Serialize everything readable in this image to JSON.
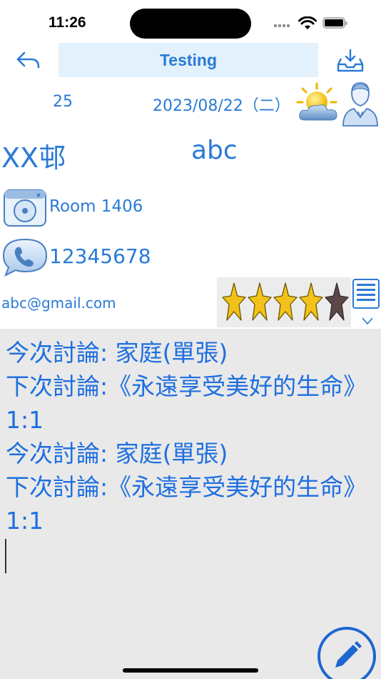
{
  "status_bar": {
    "time": "11:26"
  },
  "nav": {
    "title": "Testing"
  },
  "info": {
    "number": "25",
    "date": "2023/08/22（二）",
    "name": "XX邨",
    "label": "abc",
    "room": "Room 1406",
    "phone": "12345678",
    "email": "abc@gmail.com"
  },
  "rating": {
    "value": 4,
    "max": 5
  },
  "notes": {
    "text": "今次討論: 家庭(單張)\n下次討論:《永遠享受美好的生命》 1:1\n今次討論: 家庭(單張)\n下次討論:《永遠享受美好的生命》 1:1"
  },
  "icons": {
    "back": "back-arrow-icon",
    "download": "download-tray-icon",
    "weather": "sun-cloud-icon",
    "person": "person-icon",
    "room": "door-icon",
    "phone": "phone-icon",
    "star": "star-icon",
    "keyboard": "keyboard-icon",
    "chevron": "chevron-down-icon",
    "edit": "pencil-icon"
  },
  "colors": {
    "accent": "#2a7ad6",
    "title_bg": "#e3f1fc",
    "star_filled": "#f2c21a",
    "star_empty": "#5a4848",
    "notes_bg": "#e9e9e9"
  }
}
